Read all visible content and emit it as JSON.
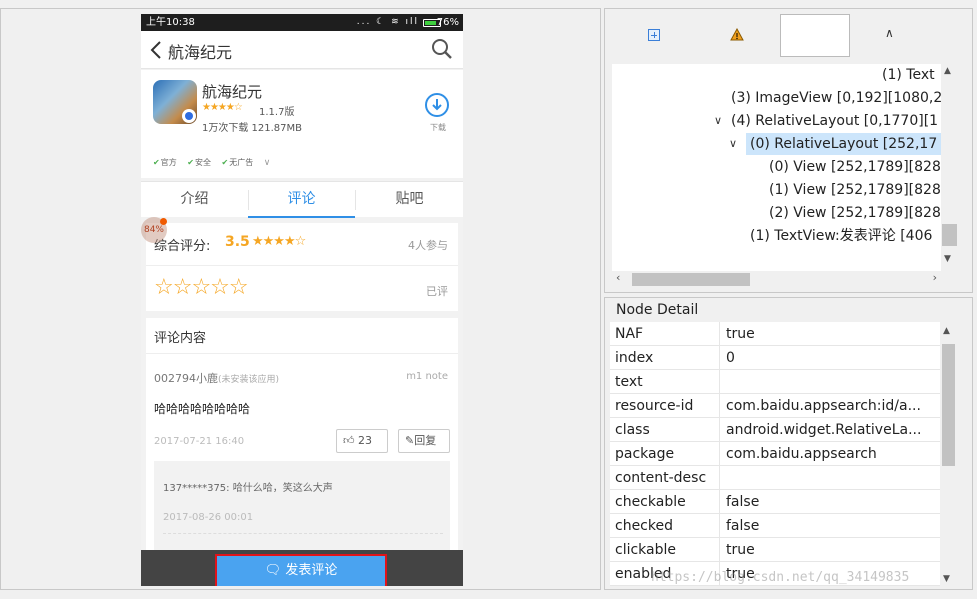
{
  "phone": {
    "status": {
      "time": "上午10:38",
      "icons": "... ☾ ≋ ıll",
      "battery": "76%",
      "battery_level": 0.76
    },
    "title": "航海纪元",
    "app": {
      "name": "航海纪元",
      "stars": "★★★★☆",
      "version": "1.1.7版",
      "downloads": "1万次下载  121.87MB",
      "download_label": "下载",
      "tags": [
        "官方",
        "安全",
        "无广告"
      ]
    },
    "tabs": [
      "介绍",
      "评论",
      "贴吧"
    ],
    "active_tab": 1,
    "score": {
      "label": "综合评分:",
      "value": "3.5",
      "stars": "★★★★☆",
      "count": "4人参与",
      "rate_stars": "☆☆☆☆☆",
      "rated": "已评",
      "bubble": "84%"
    },
    "comments": {
      "title": "评论内容",
      "user": "002794小鹿",
      "user_sub": "(未安装该应用)",
      "device": "m1 note",
      "text": "哈哈哈哈哈哈哈哈",
      "date": "2017-07-21 16:40",
      "likes": "23",
      "reply_label": "回复",
      "reply": {
        "text": "137*****375:  哈什么哈，笑这么大声",
        "date": "2017-08-26 00:01"
      }
    },
    "post_button": "发表评论"
  },
  "tree": {
    "rows": [
      {
        "text": "(1) Text",
        "indent": 0,
        "caret": "",
        "selected": false
      },
      {
        "text": "(3) ImageView [0,192][1080,2",
        "indent": 0,
        "caret": "",
        "selected": false
      },
      {
        "text": "(4) RelativeLayout [0,1770][1",
        "indent": 0,
        "caret": "∨",
        "selected": false
      },
      {
        "text": "(0) RelativeLayout [252,17",
        "indent": 1,
        "caret": "∨",
        "selected": true
      },
      {
        "text": "(0) View [252,1789][828",
        "indent": 2,
        "caret": "",
        "selected": false
      },
      {
        "text": "(1) View [252,1789][828",
        "indent": 2,
        "caret": "",
        "selected": false
      },
      {
        "text": "(2) View [252,1789][828",
        "indent": 2,
        "caret": "",
        "selected": false
      },
      {
        "text": "(1) TextView:发表评论 [406",
        "indent": 1,
        "caret": "",
        "selected": false
      }
    ]
  },
  "detail": {
    "title": "Node Detail",
    "rows": [
      {
        "key": "NAF",
        "value": "true"
      },
      {
        "key": "index",
        "value": "0"
      },
      {
        "key": "text",
        "value": ""
      },
      {
        "key": "resource-id",
        "value": "com.baidu.appsearch:id/a..."
      },
      {
        "key": "class",
        "value": "android.widget.RelativeLa..."
      },
      {
        "key": "package",
        "value": "com.baidu.appsearch"
      },
      {
        "key": "content-desc",
        "value": ""
      },
      {
        "key": "checkable",
        "value": "false"
      },
      {
        "key": "checked",
        "value": "false"
      },
      {
        "key": "clickable",
        "value": "true"
      },
      {
        "key": "enabled",
        "value": "true"
      }
    ]
  },
  "watermark": "https://blog.csdn.net/qq_34149835",
  "colors": {
    "accent": "#2f8fe6",
    "star": "#f5a623",
    "highlight_border": "#e0131a",
    "selection": "#cce5fb"
  }
}
